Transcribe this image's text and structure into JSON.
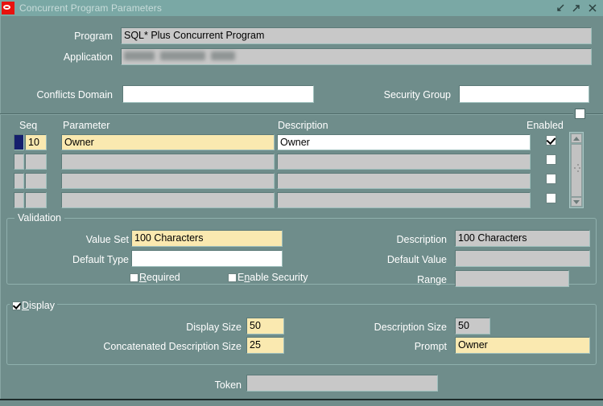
{
  "window": {
    "title": "Concurrent Program Parameters",
    "logo": "oracle-logo",
    "buttons": [
      {
        "name": "minimize",
        "glyph": "arrow-down-left"
      },
      {
        "name": "maximize",
        "glyph": "arrow-up-right"
      },
      {
        "name": "close",
        "glyph": "x"
      }
    ]
  },
  "header": {
    "program_label": "Program",
    "program_value": "SQL* Plus Concurrent Program",
    "application_label": "Application",
    "application_value": "",
    "conflicts_domain_label": "Conflicts Domain",
    "conflicts_domain_value": "",
    "security_group_label": "Security Group",
    "security_group_value": ""
  },
  "grid": {
    "columns": [
      "Seq",
      "Parameter",
      "Description",
      "Enabled"
    ],
    "rows": [
      {
        "current": true,
        "seq": "10",
        "parameter": "Owner",
        "description": "Owner",
        "enabled": true
      },
      {
        "current": false,
        "seq": "",
        "parameter": "",
        "description": "",
        "enabled": false
      },
      {
        "current": false,
        "seq": "",
        "parameter": "",
        "description": "",
        "enabled": false
      },
      {
        "current": false,
        "seq": "",
        "parameter": "",
        "description": "",
        "enabled": false
      }
    ]
  },
  "validation": {
    "title": "Validation",
    "value_set_label": "Value Set",
    "value_set_value": "100 Characters",
    "default_type_label": "Default Type",
    "default_type_value": "",
    "description_label": "Description",
    "description_value": "100 Characters",
    "default_value_label": "Default Value",
    "default_value_value": "",
    "range_label": "Range",
    "range_value": "",
    "required_label": "Required",
    "required_mnemonic": "R",
    "required_checked": false,
    "enable_security_label": "Enable Security",
    "enable_security_mnemonic": "n",
    "enable_security_checked": false
  },
  "display": {
    "title": "Display",
    "title_mnemonic": "D",
    "checked": true,
    "display_size_label": "Display Size",
    "display_size_value": "50",
    "concatenated_description_size_label": "Concatenated Description Size",
    "concatenated_description_size_value": "25",
    "description_size_label": "Description Size",
    "description_size_value": "50",
    "prompt_label": "Prompt",
    "prompt_value": "Owner"
  },
  "footer": {
    "token_label": "Token",
    "token_value": ""
  },
  "colors": {
    "window_background": "#6f8d8b",
    "titlebar": "#7aa8a5",
    "oracle_red": "#e8120e",
    "field_required": "#fae9b0",
    "field_readonly": "#c8c8c8",
    "field_editable": "#ffffff",
    "record_indicator": "#151f6d"
  }
}
